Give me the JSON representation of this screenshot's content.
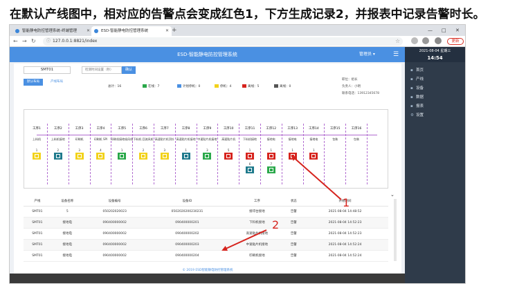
{
  "slide_title": "在默认产线图中，相对应的告警点会变成红色1，下方生成记录2，并报表中记录告警时长。",
  "browser": {
    "tabs": [
      "智能静电防控管理系统-终端管理",
      "ESD-智能静电防控管理系统"
    ],
    "new_tab": "+",
    "url": "127.0.0.1:8821/index",
    "update_label": "更新",
    "win_min": "—",
    "win_max": "□",
    "win_close": "✕"
  },
  "app": {
    "title": "ESD-智能静电防控管理系统",
    "user": "管理员 ▾",
    "clock_date": "2021-08-04 星期三",
    "clock_time": "14:54",
    "menu": [
      "首页",
      "产线",
      "设备",
      "数据",
      "报表",
      "设置"
    ],
    "search_value": "SMT01",
    "search_placeholder": "检测时间设置（秒）",
    "confirm_label": "确认",
    "view_default": "默认布局",
    "view_line": "产线布局",
    "stats": {
      "total": "总计：16",
      "online": "在线：7",
      "planned": "计划停机：0",
      "stopped": "停机：4",
      "abnormal": "离线：5",
      "offline": "离线：0"
    },
    "info": {
      "position": "职位：组长",
      "owner": "负责人：小明",
      "phone": "联系电话：13912345678"
    },
    "stations": [
      {
        "name": "工序1",
        "device": "上料机",
        "num": "1",
        "color": "#f2d21b"
      },
      {
        "name": "工序2",
        "device": "上料机接地",
        "num": "2",
        "color": "#1f7a8c"
      },
      {
        "name": "工序3",
        "device": "印刷机",
        "num": "3",
        "color": "#f2d21b"
      },
      {
        "name": "工序4",
        "device": "印刷机 SPI",
        "num": "4",
        "color": "#f2d21b"
      },
      {
        "name": "工序5",
        "device": "印刷机接地吸风机",
        "num": "1",
        "color": "#2aa84a"
      },
      {
        "name": "工序6",
        "device": "下料机 回流风机",
        "num": "2",
        "color": "#f2d21b"
      },
      {
        "name": "工序7",
        "device": "高速贴片机顶针",
        "num": "3",
        "color": "#f2d21b"
      },
      {
        "name": "工序8",
        "device": "高速贴片机接地",
        "num": "1",
        "color": "#1f7a8c"
      },
      {
        "name": "工序9",
        "device": "中速贴片机接地",
        "num": "3",
        "color": "#2aa84a"
      },
      {
        "name": "工序10",
        "device": "高速贴片机",
        "num": "5",
        "color": "#d6241e"
      },
      {
        "name": "工序11",
        "device": "下料机接地",
        "num": "1",
        "color": "#d6241e"
      },
      {
        "name": "工序12",
        "device": "接地电",
        "num": "1",
        "color": "#d6241e"
      },
      {
        "name": "工序13",
        "device": "接地电",
        "num": "1",
        "color": "#d6241e"
      },
      {
        "name": "工序14",
        "device": "接地电",
        "num": "1",
        "color": "#d6241e"
      },
      {
        "name": "工序15",
        "device": "包装",
        "num": "",
        "color": ""
      },
      {
        "name": "工序16",
        "device": "包装",
        "num": "",
        "color": ""
      }
    ],
    "extra_devices": [
      {
        "station": 10,
        "num": "6",
        "color": "#1f7a8c"
      },
      {
        "station": 11,
        "num": "7",
        "color": "#2aa84a"
      }
    ],
    "table": {
      "headers": [
        "产线",
        "设备名称",
        "设备编号",
        "设备ID",
        "工序",
        "状态",
        "开始时间"
      ],
      "rows": [
        [
          "SMT01",
          "5",
          "050202020023",
          "0502020200230231",
          "接印台接地",
          "告警",
          "2021-08-04 14:48:52"
        ],
        [
          "SMT01",
          "接地电",
          "090400000002",
          "090400000201",
          "下料机接地",
          "告警",
          "2021-08-04 14:52:23"
        ],
        [
          "SMT01",
          "接地电",
          "090400000002",
          "090400000202",
          "高速贴片机接地",
          "告警",
          "2021-08-04 14:52:23"
        ],
        [
          "SMT01",
          "接地电",
          "090400000002",
          "090400000203",
          "中速贴片机接地",
          "告警",
          "2021-08-04 14:52:24"
        ],
        [
          "SMT01",
          "接地电",
          "090400000002",
          "090400000204",
          "印刷机接地",
          "告警",
          "2021-08-04 14:52:24"
        ]
      ]
    },
    "footer": "© 2019 ESD智能静电防控管理系统"
  },
  "annotations": {
    "label1": "1",
    "label2": "2",
    "color": "#d6241e"
  }
}
